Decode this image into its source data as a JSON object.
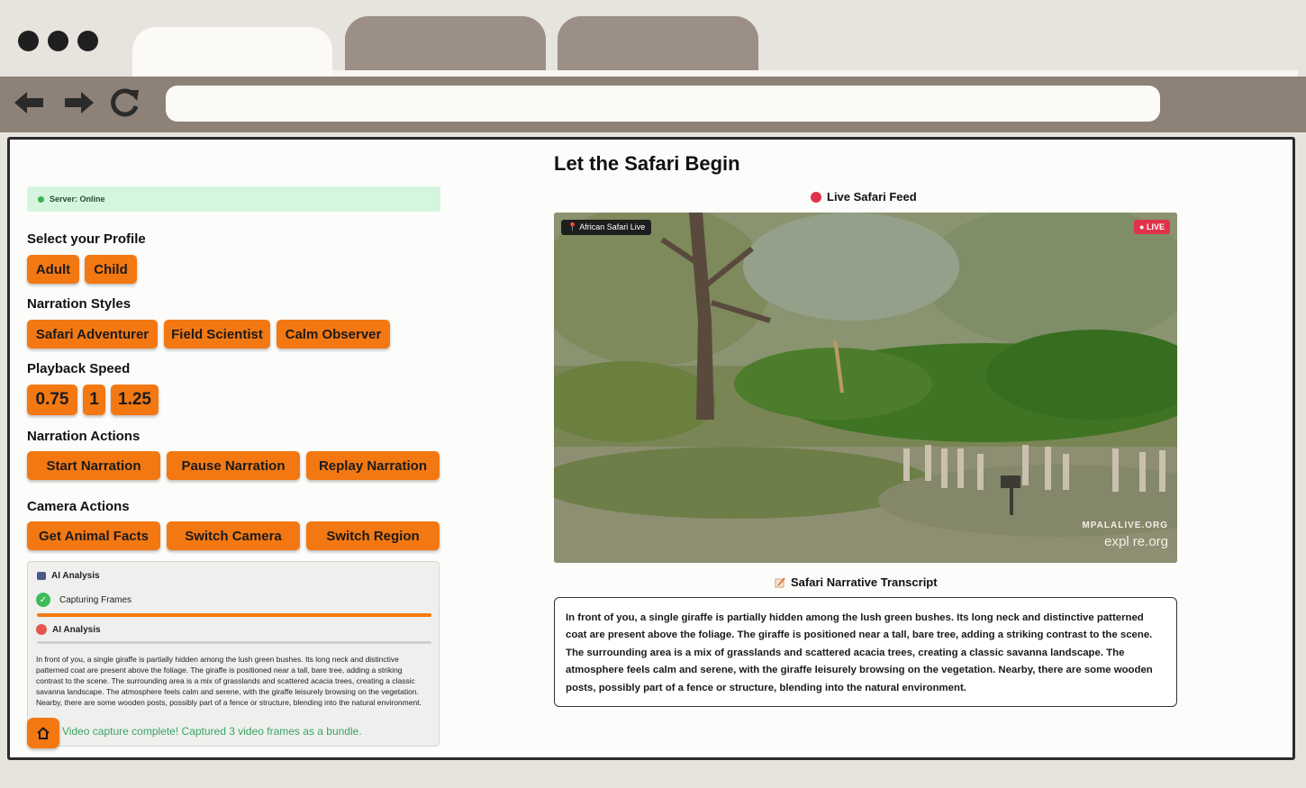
{
  "browser": {
    "tabs": [
      {
        "label": "",
        "active": true
      },
      {
        "label": "",
        "active": false
      },
      {
        "label": "",
        "active": false
      }
    ],
    "url": ""
  },
  "server_status": "Server: Online",
  "profile": {
    "title": "Select your Profile",
    "options": [
      "Adult",
      "Child"
    ]
  },
  "narration_styles": {
    "title": "Narration Styles",
    "options": [
      "Safari Adventurer",
      "Field Scientist",
      "Calm Observer"
    ]
  },
  "playback_speed": {
    "title": "Playback Speed",
    "options": [
      "0.75",
      "1",
      "1.25"
    ]
  },
  "narration_actions": {
    "title": "Narration Actions",
    "buttons": [
      "Start Narration",
      "Pause Narration",
      "Replay Narration"
    ]
  },
  "camera_actions": {
    "title": "Camera Actions",
    "buttons": [
      "Get Animal Facts",
      "Switch Camera",
      "Switch Region"
    ]
  },
  "ai_panel": {
    "title": "AI Analysis",
    "step1": "Capturing Frames",
    "step1_progress": 1.0,
    "step2": "AI Analysis",
    "step2_progress": 0.0,
    "text": "In front of you, a single giraffe is partially hidden among the lush green bushes. Its long neck and distinctive patterned coat are present above the foliage. The giraffe is positioned near a tall, bare tree, adding a striking contrast to the scene. The surrounding area is a mix of grasslands and scattered acacia trees, creating a classic savanna landscape. The atmosphere feels calm and serene, with the giraffe leisurely browsing on the vegetation. Nearby, there are some wooden posts, possibly part of a fence or structure, blending into the natural environment.",
    "status": "Video capture complete! Captured 3 video frames as a bundle."
  },
  "main": {
    "title": "Let the Safari Begin",
    "feed_label": "Live Safari Feed",
    "video_source_badge": "African Safari Live",
    "live_badge": "● LIVE",
    "watermark_line1": "MPALALIVE.ORG",
    "watermark_line2": "expl re.org",
    "transcript_label": "Safari Narrative Transcript",
    "transcript": "In front of you, a single giraffe is partially hidden among the lush green bushes. Its long neck and distinctive patterned coat are present above the foliage. The giraffe is positioned near a tall, bare tree, adding a striking contrast to the scene. The surrounding area is a mix of grasslands and scattered acacia trees, creating a classic savanna landscape. The atmosphere feels calm and serene, with the giraffe leisurely browsing on the vegetation. Nearby, there are some wooden posts, possibly part of a fence or structure, blending into the natural environment."
  },
  "colors": {
    "accent": "#f47812",
    "server_bg": "#d6f5de",
    "live_red": "#e0334a",
    "success_green": "#3aa463"
  }
}
